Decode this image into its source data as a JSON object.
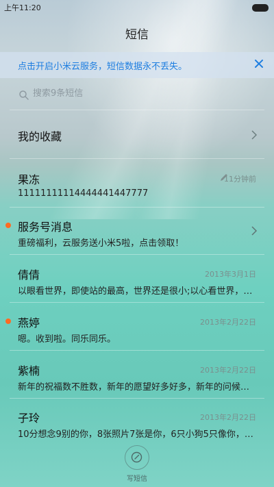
{
  "status_bar": {
    "time": "上午11:20"
  },
  "header": {
    "title": "短信"
  },
  "banner": {
    "text": "点击开启小米云服务，短信数据永不丢失。"
  },
  "search": {
    "placeholder": "搜索9条短信"
  },
  "favorites": {
    "label": "我的收藏"
  },
  "conversations": [
    {
      "name": "果冻",
      "preview": "11111111114444441447777",
      "time": "11分钟前",
      "unread": false,
      "draft": true
    },
    {
      "name": "服务号消息",
      "preview": "重磅福利，云服务送小米5啦，点击领取！",
      "time": "",
      "unread": true,
      "chevron": true
    },
    {
      "name": "倩倩",
      "preview": "以眼看世界，即使站的最高，世界还是很小;以心看世界，…",
      "time": "2013年3月1日",
      "unread": false
    },
    {
      "name": "燕婷",
      "preview": "嗯。收到啦。同乐同乐。",
      "time": "2013年2月22日",
      "unread": true
    },
    {
      "name": "紫楠",
      "preview": "新年的祝福数不胜数，新年的愿望好多好多，新年的问候…",
      "time": "2013年2月22日",
      "unread": false
    },
    {
      "name": "子玲",
      "preview": "10分想念9别的你，8张照片7张是你，6只小狗5只像你，4…",
      "time": "2013年2月22日",
      "unread": false
    }
  ],
  "compose": {
    "label": "写短信"
  },
  "colors": {
    "accent": "#1e7ee0",
    "unread_dot": "#ff6a22"
  }
}
